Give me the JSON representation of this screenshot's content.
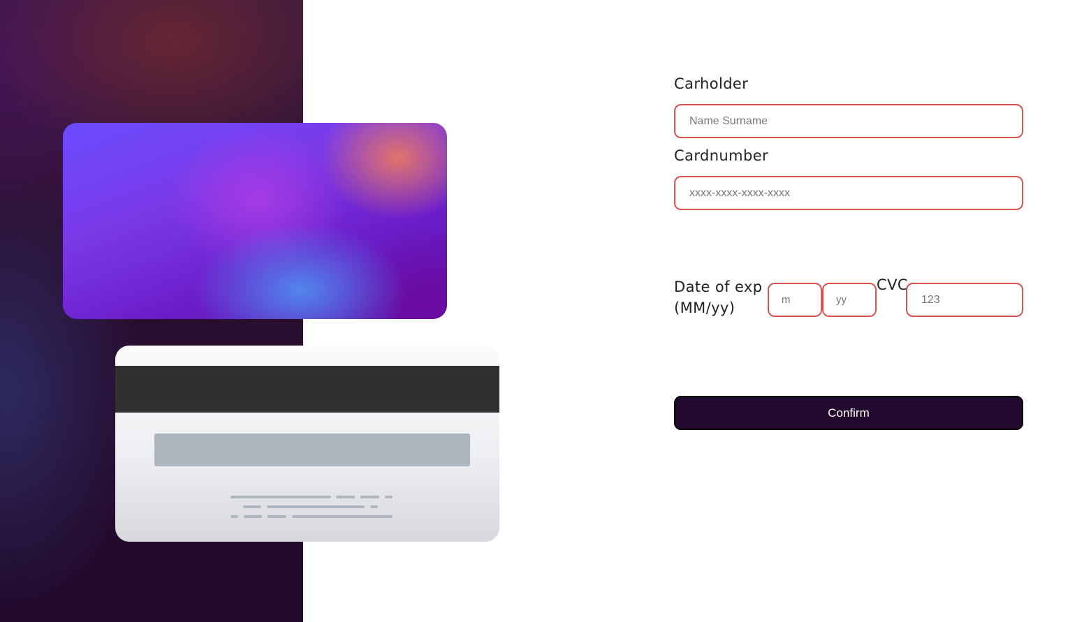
{
  "form": {
    "cardholder": {
      "label": "Carholder",
      "placeholder": "Name Surname",
      "value": ""
    },
    "cardnumber": {
      "label": "Cardnumber",
      "placeholder": "xxxx-xxxx-xxxx-xxxx",
      "value": ""
    },
    "expiry": {
      "label_line1": "Date of exp",
      "label_line2": "(MM/yy)",
      "month_placeholder": "m",
      "year_placeholder": "yy"
    },
    "cvc": {
      "label": "CVC",
      "placeholder": "123"
    },
    "confirm_label": "Confirm"
  },
  "colors": {
    "input_border": "#d9534f",
    "button_bg": "#220a2e",
    "panel_bg": "#210a2c",
    "card_back_stripe": "#303030",
    "card_back_signature": "#adb5bf"
  }
}
